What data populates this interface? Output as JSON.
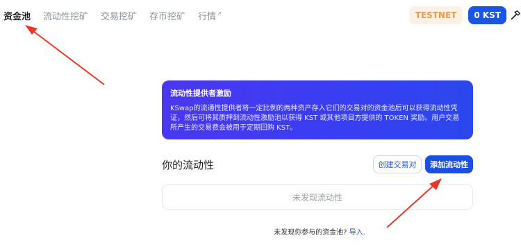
{
  "nav": {
    "items": [
      {
        "label": "资金池",
        "active": true
      },
      {
        "label": "流动性挖矿",
        "active": false
      },
      {
        "label": "交易挖矿",
        "active": false
      },
      {
        "label": "存币挖矿",
        "active": false
      },
      {
        "label": "行情",
        "active": false,
        "external_arrow": "↗"
      }
    ],
    "testnet_label": "TESTNET",
    "balance_label": "0 KST",
    "tool_icon": "hammer-icon"
  },
  "info_card": {
    "title": "流动性提供者激励",
    "body": "KSwap的流通性提供者将一定比例的两种资产存入它们的交易对的资金池后可以获得流动性凭证，然后可将其质押到流动性激励池以获得 KST 或其他项目方提供的 TOKEN 奖励。用户交易所产生的交易费会被用于定期回购 KST。"
  },
  "liquidity": {
    "title": "你的流动性",
    "create_pair_label": "创建交易对",
    "add_liquidity_label": "添加流动性",
    "empty_text": "未发现流动性"
  },
  "footer": {
    "prompt": "未发现你参与的资金池?",
    "import_link": "导入",
    "period": "."
  },
  "colors": {
    "accent": "#1b4fe0",
    "annotation_arrow": "#e8382a",
    "testnet_bg": "#fdf1e7",
    "testnet_text": "#f59a3f"
  }
}
